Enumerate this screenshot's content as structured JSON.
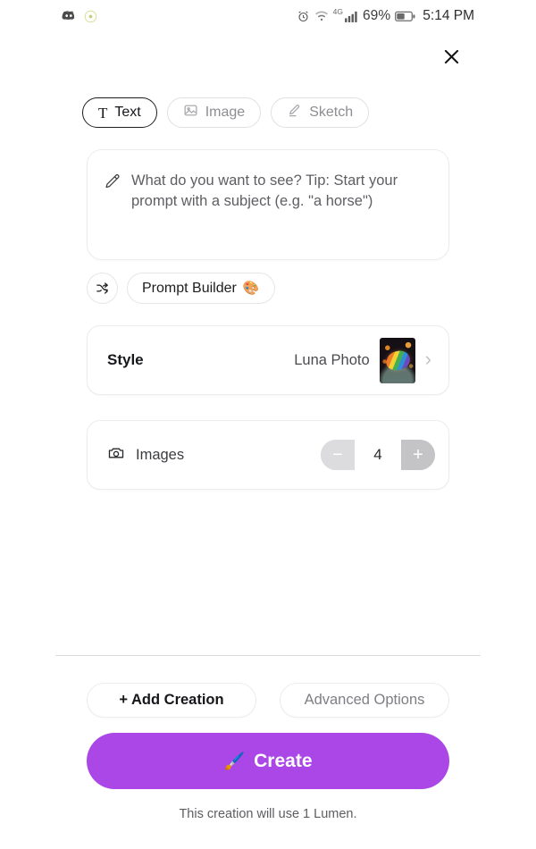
{
  "statusbar": {
    "left_icons": [
      {
        "name": "discord-icon",
        "glyph": "discord"
      },
      {
        "name": "app-dot-icon",
        "glyph": "dot-circle"
      }
    ],
    "alarm_icon": "alarm-clock-icon",
    "wifi_icon": "wifi-icon",
    "network_label": "4G",
    "signal_icon": "cellular-signal-icon",
    "battery_percent": "69%",
    "battery_icon": "battery-icon",
    "time": "5:14 PM"
  },
  "header": {
    "close_label": "✕"
  },
  "tabs": [
    {
      "id": "text",
      "label": "Text",
      "icon": "text-icon",
      "selected": true
    },
    {
      "id": "image",
      "label": "Image",
      "icon": "image-icon",
      "selected": false
    },
    {
      "id": "sketch",
      "label": "Sketch",
      "icon": "sketch-icon",
      "selected": false
    }
  ],
  "prompt": {
    "icon": "pencil-icon",
    "placeholder": "What do you want to see? Tip: Start your prompt with a subject (e.g. \"a horse\")",
    "value": ""
  },
  "builder_row": {
    "shuffle_icon": "shuffle-icon",
    "builder_label": "Prompt Builder",
    "builder_emoji": "🎨"
  },
  "options": {
    "style": {
      "label": "Style",
      "value": "Luna Photo",
      "thumbnail": "style-preview-thumbnail",
      "chevron": "›"
    },
    "images": {
      "icon": "camera-icon",
      "label": "Images",
      "count": "4",
      "minus_label": "−",
      "plus_label": "+"
    }
  },
  "footer": {
    "add_creation_label": "+ Add Creation",
    "advanced_options_label": "Advanced Options",
    "create_label": "Create",
    "create_emoji": "🖌️",
    "note": "This creation will use 1 Lumen."
  },
  "colors": {
    "accent_purple": "#aa47e6",
    "selected_border": "#1d1d1f",
    "muted_text": "#8d8d92"
  }
}
